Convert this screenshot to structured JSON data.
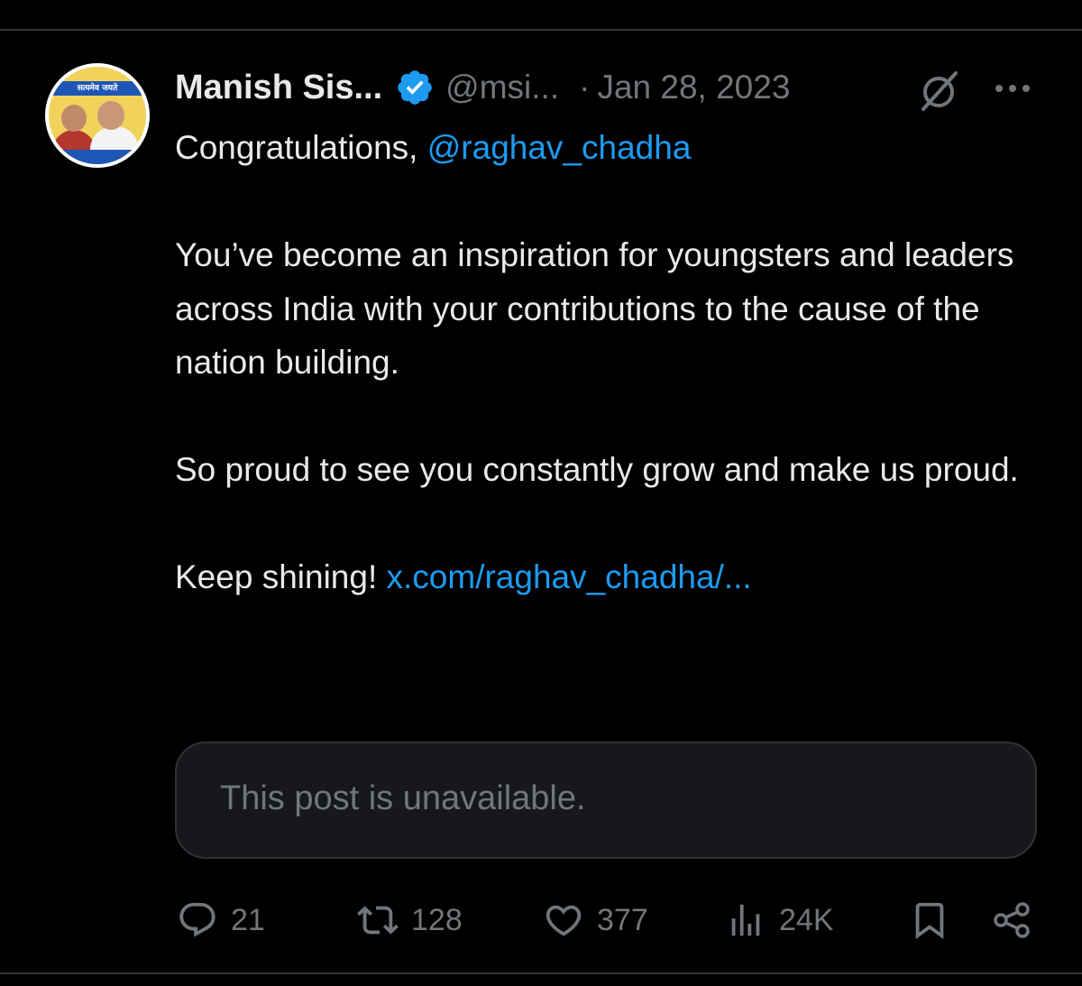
{
  "post": {
    "author": {
      "display_name": "Manish Sis...",
      "handle": "@msi...",
      "verified": true,
      "avatar_banner_text": "सत्यमेव जयते"
    },
    "separator": "·",
    "date": "Jan 28, 2023",
    "text": {
      "line1_prefix": "Congratulations, ",
      "line1_mention": "@raghav_chadha",
      "paragraph2": "You’ve become an inspiration for youngsters and leaders across India with your contributions to the cause of the nation building.",
      "paragraph3": "So proud to see you constantly grow and make us proud.",
      "paragraph4_prefix": "Keep shining! ",
      "paragraph4_link": "x.com/raghav_chadha/..."
    },
    "quoted_post": {
      "text": "This post is unavailable."
    },
    "actions": {
      "replies": "21",
      "reposts": "128",
      "likes": "377",
      "views": "24K"
    }
  },
  "colors": {
    "background": "#000000",
    "text": "#e7e9ea",
    "secondary_text": "#71767b",
    "accent": "#1d9bf0",
    "border": "#2f3336",
    "card_background": "#16181c"
  },
  "icons": {
    "verified": "verified-badge-icon",
    "grok": "grok-icon",
    "more": "more-icon",
    "reply": "reply-icon",
    "repost": "repost-icon",
    "like": "heart-icon",
    "views": "views-icon",
    "bookmark": "bookmark-icon",
    "share": "share-icon"
  }
}
